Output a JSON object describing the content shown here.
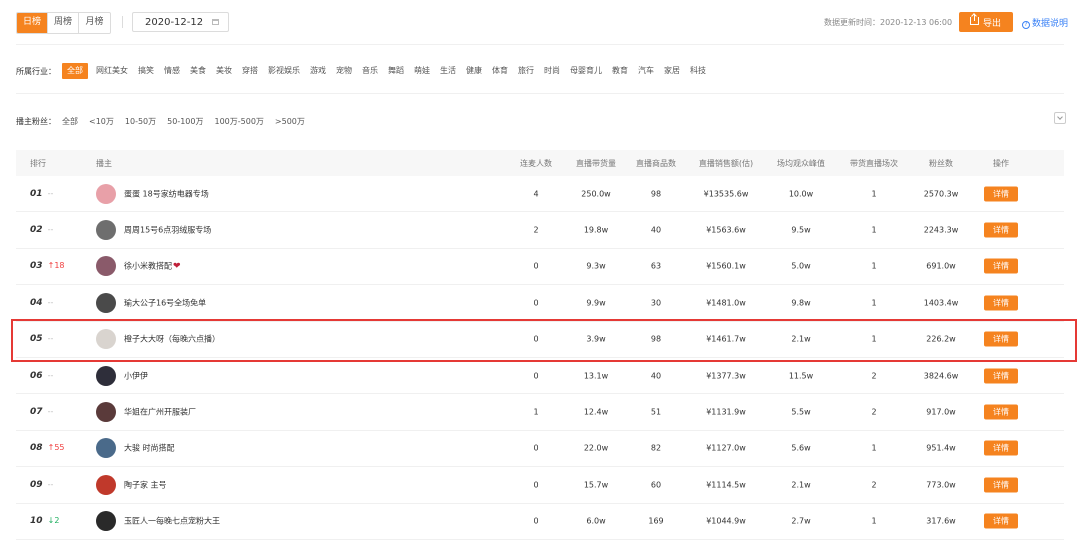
{
  "period_tabs": [
    {
      "label": "日榜",
      "active": true
    },
    {
      "label": "周榜",
      "active": false
    },
    {
      "label": "月榜",
      "active": false
    }
  ],
  "date_picker": {
    "value": "2020-12-12"
  },
  "update_time": "数据更新时间：2020-12-13 06:00",
  "export_label": "导出",
  "help_label": "数据说明",
  "industry": {
    "label": "所属行业：",
    "items": [
      "全部",
      "网红美女",
      "搞笑",
      "情感",
      "美食",
      "美妆",
      "穿搭",
      "影视娱乐",
      "游戏",
      "宠物",
      "音乐",
      "舞蹈",
      "萌娃",
      "生活",
      "健康",
      "体育",
      "旅行",
      "时尚",
      "母婴育儿",
      "教育",
      "汽车",
      "家居",
      "科技"
    ]
  },
  "fans": {
    "label": "播主粉丝：",
    "items": [
      "全部",
      "<10万",
      "10-50万",
      "50-100万",
      "100万-500万",
      ">500万"
    ]
  },
  "table": {
    "headers": {
      "rank": "排行",
      "anchor": "播主",
      "linked_users": "连麦人数",
      "live_items": "直播带货量",
      "goods_count": "直播商品数",
      "sales": "直播销售额(估)",
      "peak_viewers": "场均观众峰值",
      "sessions": "带货直播场次",
      "fans": "粉丝数",
      "action": "操作"
    },
    "detail_label": "详情",
    "rows": [
      {
        "rank": "01",
        "change": "--",
        "change_type": "same",
        "name": "蛋蛋 18号家纺电器专场",
        "heart": "",
        "avatar_color": "#e8a0a8",
        "linked": "4",
        "items": "250.0w",
        "goods": "98",
        "sales": "¥13535.6w",
        "peak": "10.0w",
        "sessions": "1",
        "fans": "2570.3w"
      },
      {
        "rank": "02",
        "change": "--",
        "change_type": "same",
        "name": "周周15号6点羽绒服专场",
        "heart": "",
        "avatar_color": "#6e6e6e",
        "linked": "2",
        "items": "19.8w",
        "goods": "40",
        "sales": "¥1563.6w",
        "peak": "9.5w",
        "sessions": "1",
        "fans": "2243.3w"
      },
      {
        "rank": "03",
        "change": "↑18",
        "change_type": "up",
        "name": "徐小米教搭配",
        "heart": "❤",
        "avatar_color": "#8a5a6a",
        "linked": "0",
        "items": "9.3w",
        "goods": "63",
        "sales": "¥1560.1w",
        "peak": "5.0w",
        "sessions": "1",
        "fans": "691.0w"
      },
      {
        "rank": "04",
        "change": "--",
        "change_type": "same",
        "name": "瑜大公子16号全场免单",
        "heart": "",
        "avatar_color": "#4a4a4a",
        "linked": "0",
        "items": "9.9w",
        "goods": "30",
        "sales": "¥1481.0w",
        "peak": "9.8w",
        "sessions": "1",
        "fans": "1403.4w"
      },
      {
        "rank": "05",
        "change": "--",
        "change_type": "same",
        "name": "橙子大大呀（每晚六点播）",
        "heart": "",
        "avatar_color": "#d9d4cf",
        "linked": "0",
        "items": "3.9w",
        "goods": "98",
        "sales": "¥1461.7w",
        "peak": "2.1w",
        "sessions": "1",
        "fans": "226.2w"
      },
      {
        "rank": "06",
        "change": "--",
        "change_type": "same",
        "name": "小伊伊",
        "heart": "",
        "avatar_color": "#2e2e3a",
        "linked": "0",
        "items": "13.1w",
        "goods": "40",
        "sales": "¥1377.3w",
        "peak": "11.5w",
        "sessions": "2",
        "fans": "3824.6w"
      },
      {
        "rank": "07",
        "change": "--",
        "change_type": "same",
        "name": "华姐在广州开服装厂",
        "heart": "",
        "avatar_color": "#5a3a3a",
        "linked": "1",
        "items": "12.4w",
        "goods": "51",
        "sales": "¥1131.9w",
        "peak": "5.5w",
        "sessions": "2",
        "fans": "917.0w"
      },
      {
        "rank": "08",
        "change": "↑55",
        "change_type": "up",
        "name": "大骏 时尚搭配",
        "heart": "",
        "avatar_color": "#4a6a8a",
        "linked": "0",
        "items": "22.0w",
        "goods": "82",
        "sales": "¥1127.0w",
        "peak": "5.6w",
        "sessions": "1",
        "fans": "951.4w"
      },
      {
        "rank": "09",
        "change": "--",
        "change_type": "same",
        "name": "陶子家 主号",
        "heart": "",
        "avatar_color": "#c0392b",
        "linked": "0",
        "items": "15.7w",
        "goods": "60",
        "sales": "¥1114.5w",
        "peak": "2.1w",
        "sessions": "2",
        "fans": "773.0w"
      },
      {
        "rank": "10",
        "change": "↓2",
        "change_type": "down",
        "name": "玉匠人一每晚七点宠粉大王",
        "heart": "",
        "avatar_color": "#2a2a2a",
        "linked": "0",
        "items": "6.0w",
        "goods": "169",
        "sales": "¥1044.9w",
        "peak": "2.7w",
        "sessions": "1",
        "fans": "317.6w"
      }
    ]
  },
  "colors": {
    "accent": "#f5831f",
    "highlight": "#e53935",
    "up": "#f04040",
    "down": "#20b060",
    "link": "#3b82f6"
  },
  "icons": {
    "date_picker": "calendar-icon",
    "export": "export-icon",
    "help": "help-circle-icon",
    "collapse": "chevron-down-icon",
    "heart": "heart-icon"
  }
}
